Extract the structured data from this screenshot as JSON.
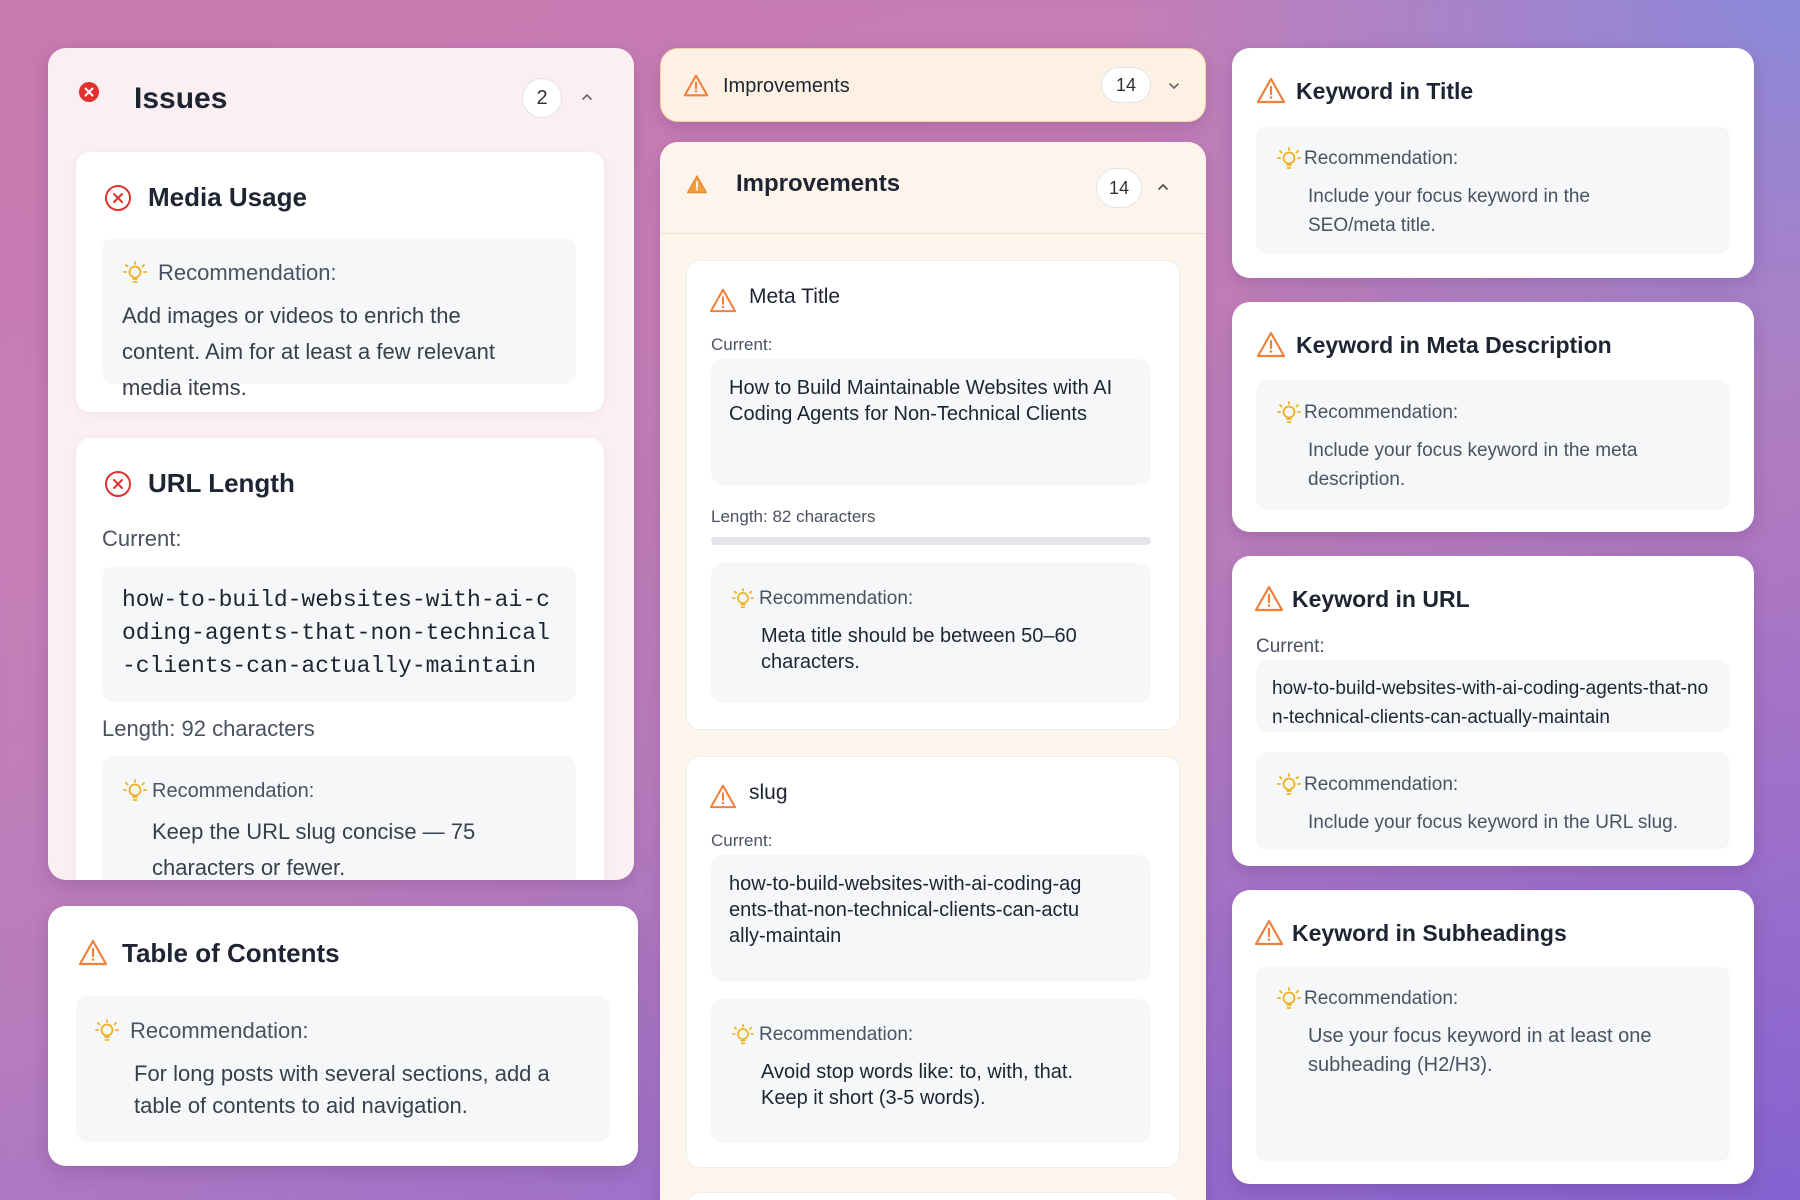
{
  "issues": {
    "title": "Issues",
    "count": "2",
    "media": {
      "title": "Media Usage",
      "rec_label": "Recommendation:",
      "rec_text": "Add images or videos to enrich the content. Aim for at least a few relevant media items."
    },
    "url": {
      "title": "URL Length",
      "current_label": "Current:",
      "current_value": "how-to-build-websites-with-ai-c\noding-agents-that-non-technical\n-clients-can-actually-maintain",
      "length_text": "Length: 92 characters",
      "rec_label": "Recommendation:",
      "rec_text": "Keep the URL slug concise — 75 characters or fewer."
    }
  },
  "toc": {
    "title": "Table of Contents",
    "rec_label": "Recommendation:",
    "rec_text": "For long posts with several sections, add a table of contents to aid navigation."
  },
  "improvements_collapsed": {
    "title": "Improvements",
    "count": "14"
  },
  "improvements": {
    "title": "Improvements",
    "count": "14",
    "meta_title": {
      "title": "Meta Title",
      "current_label": "Current:",
      "current_value": "How to Build Maintainable Websites with AI Coding Agents for Non-Technical Clients",
      "length_text": "Length: 82 characters",
      "rec_label": "Recommendation:",
      "rec_text": "Meta title should be between 50–60 characters."
    },
    "slug": {
      "title": "slug",
      "current_label": "Current:",
      "current_value": "how-to-build-websites-with-ai-coding-agents-that-non-technical-clients-can-actually-maintain",
      "rec_label": "Recommendation:",
      "rec_text": "Avoid stop words like: to, with, that. Keep it short (3-5 words)."
    }
  },
  "keyword_title": {
    "title": "Keyword in Title",
    "rec_label": "Recommendation:",
    "rec_text": "Include your focus keyword in the SEO/meta title."
  },
  "keyword_meta": {
    "title": "Keyword in Meta Description",
    "rec_label": "Recommendation:",
    "rec_text": "Include your focus keyword in the meta description."
  },
  "keyword_url": {
    "title": "Keyword in URL",
    "current_label": "Current:",
    "current_value": "how-to-build-websites-with-ai-coding-agents-that-non-technical-clients-can-actually-maintain",
    "rec_label": "Recommendation:",
    "rec_text": "Include your focus keyword in the URL slug."
  },
  "keyword_subheadings": {
    "title": "Keyword in Subheadings",
    "rec_label": "Recommendation:",
    "rec_text": "Use your focus keyword in at least one subheading (H2/H3)."
  },
  "colors": {
    "error": "#e0312f",
    "warning": "#f0803c",
    "bulb": "#f2b01e"
  },
  "icons": [
    "error-circle-icon",
    "warning-triangle-icon",
    "lightbulb-icon",
    "chevron-up-icon",
    "chevron-down-icon"
  ]
}
